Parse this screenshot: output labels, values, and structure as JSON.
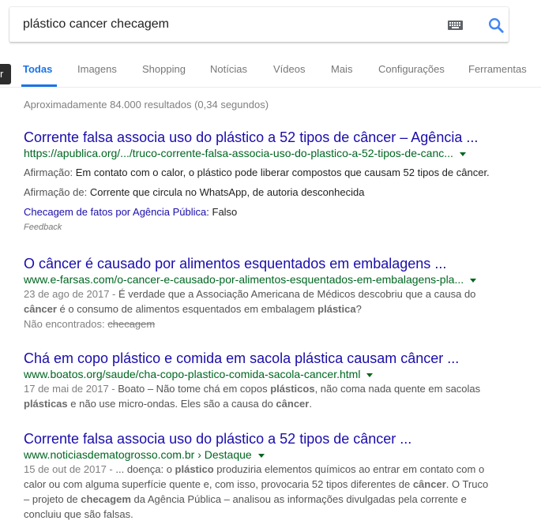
{
  "search": {
    "query": "plástico cancer checagem"
  },
  "tooltip": "r",
  "tabs": [
    "Todas",
    "Imagens",
    "Shopping",
    "Notícias",
    "Vídeos",
    "Mais",
    "Configurações",
    "Ferramentas"
  ],
  "stats": "Aproximadamente 84.000 resultados (0,34 segundos)",
  "results": [
    {
      "title": "Corrente falsa associa uso do plástico a 52 tipos de câncer – Agência ...",
      "url": "https://apublica.org/.../truco-corrente-falsa-associa-uso-do-plastico-a-52-tipos-de-canc...",
      "claim_label": "Afirmação:",
      "claim_value": "Em contato com o calor, o plástico pode liberar compostos que causam 52 tipos de câncer.",
      "claimed_by_label": "Afirmação de:",
      "claimed_by_value": "Corrente que circula no WhatsApp, de autoria desconhecida",
      "fact_label": "Checagem de fatos por Agência Pública:",
      "fact_value": "Falso",
      "feedback": "Feedback"
    },
    {
      "title": "O câncer é causado por alimentos esquentados em embalagens ...",
      "url": "www.e-farsas.com/o-cancer-e-causado-por-alimentos-esquentados-em-embalagens-pla...",
      "date": "23 de ago de 2017 - ",
      "s1": "É verdade que a Associação Americana de Médicos descobriu que a causa do",
      "b1": "câncer",
      "s2": " é o consumo de alimentos esquentados em embalagem ",
      "b2": "plástica",
      "s3": "?",
      "missing_label": "Não encontrados: ",
      "missing_value": "checagem"
    },
    {
      "title": "Chá em copo plástico e comida em sacola plástica causam câncer ...",
      "url": "www.boatos.org/saude/cha-copo-plastico-comida-sacola-cancer.html",
      "date": "17 de mai de 2017 - ",
      "s1": "Boato – Não tome chá em copos ",
      "b1": "plásticos",
      "s2": ", não coma nada quente em sacolas",
      "b2": "plásticas",
      "s3": " e não use micro-ondas. Eles são a causa do ",
      "b3": "câncer",
      "s4": "."
    },
    {
      "title": "Corrente falsa associa uso do plástico a 52 tipos de câncer ...",
      "url": "www.noticiasdematogrosso.com.br › Destaque",
      "date": "15 de out de 2017 - ",
      "s1": "... doença: o ",
      "b1": "plástico",
      "s2": " produziria elementos químicos ao entrar em contato com o",
      "s3": "calor ou com alguma superfície quente e, com isso, provocaria 52 tipos diferentes de ",
      "b2": "câncer",
      "s4": ". O Truco",
      "s5": "– projeto de ",
      "b3": "checagem",
      "s6": " da Agência Pública – analisou as informações divulgadas pela corrente e",
      "s7": "concluiu que são falsas."
    }
  ]
}
